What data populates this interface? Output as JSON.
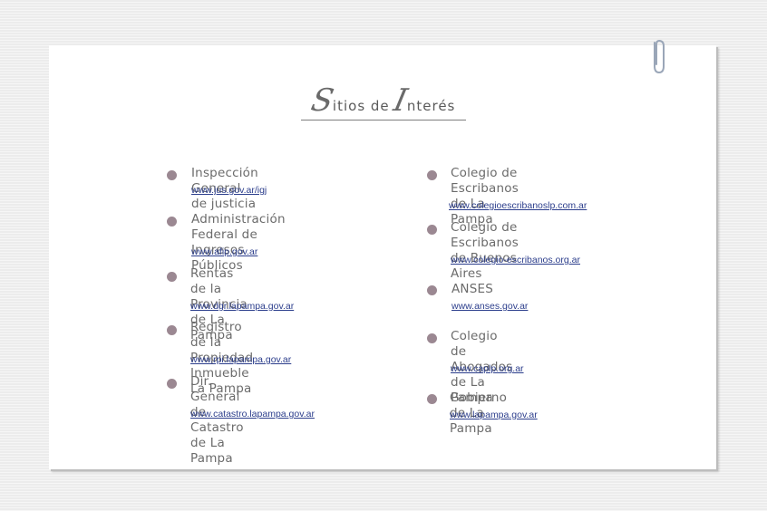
{
  "page": {
    "title_first_initial": "S",
    "title_first_rest": "itios de ",
    "title_second_initial": "I",
    "title_second_rest": "nterés"
  },
  "colors": {
    "bullet": "#9b8892",
    "link": "#2c3e8c",
    "text": "#6b6b6b"
  },
  "left_column": [
    {
      "name": "Inspección General de justicia",
      "url": "www.jus.gov.ar/igj"
    },
    {
      "name": "Administración Federal de\nIngresos Públicos",
      "url": "www.afip.gov.ar"
    },
    {
      "name": "Rentas de la Provincia\nde La Pampa",
      "url": "www.dgr.lapampa.gov.ar"
    },
    {
      "name": "Registro de la Propiedad\nInmueble La Pampa",
      "url": "www.rpi.lapampa.gov.ar"
    },
    {
      "name": "Dir. General de Catastro\nde La Pampa",
      "url": "www.catastro.lapampa.gov.ar"
    }
  ],
  "right_column": [
    {
      "name": "Colegio de Escribanos\nde La Pampa",
      "url": "www.colegioescribanoslp.com.ar"
    },
    {
      "name": "Colegio de Escribanos\nde Buenos Aires",
      "url": "www.colegio-escribanos.org.ar"
    },
    {
      "name": "ANSES",
      "url": "www.anses.gov.ar"
    },
    {
      "name": "Colegio de Abogados\nde La Pampa",
      "url": "www.caplp.org.ar"
    },
    {
      "name": "Gobierno de La Pampa",
      "url": "www.lapampa.gov.ar"
    }
  ]
}
